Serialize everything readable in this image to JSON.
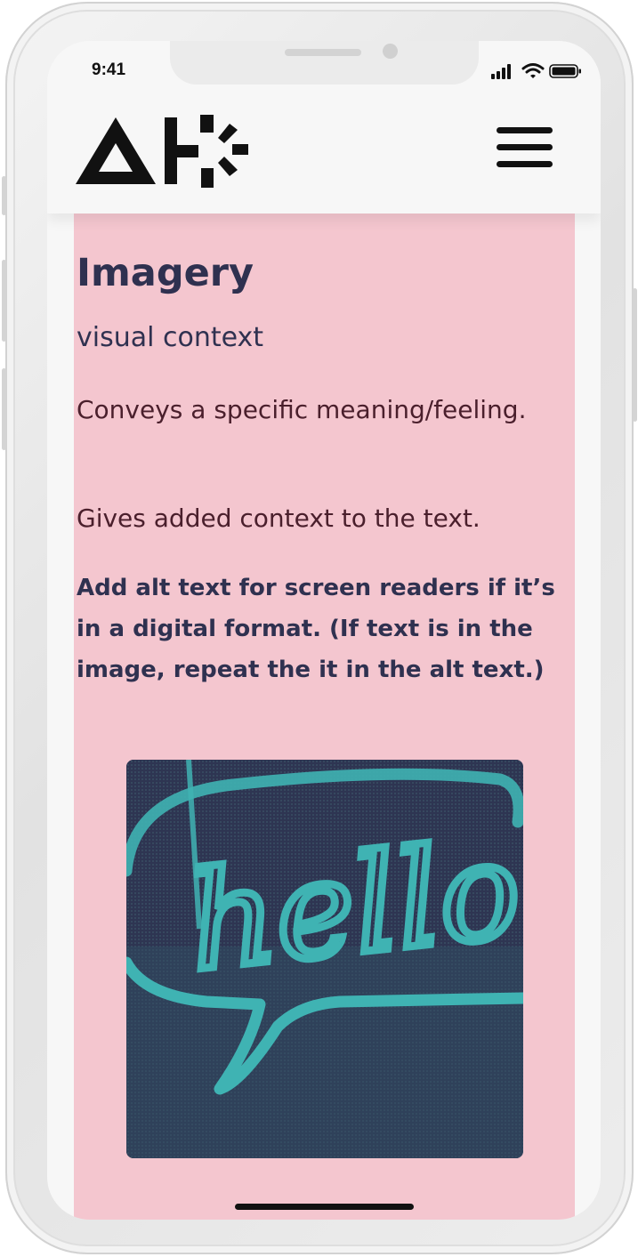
{
  "status_bar": {
    "time": "9:41",
    "icons": [
      "cellular-signal-icon",
      "wifi-icon",
      "battery-icon"
    ]
  },
  "header": {
    "logo_name": "alt-logo",
    "menu_icon": "hamburger-menu-icon"
  },
  "content": {
    "title": "Imagery",
    "subtitle": "visual context",
    "paragraphs": [
      "Conveys a specific meaning/feeling.",
      "Gives added context to the text."
    ],
    "note": "Add alt text for screen readers if it’s in a digital format. (If text is in the image, repeat the it in the alt text.)",
    "image_alt": "Neon sign reading hello inside a speech bubble",
    "image_text": "hello"
  },
  "colors": {
    "card_background": "#f4c6cf",
    "heading_text": "#2f3150",
    "body_text": "#4a1f2c",
    "neon": "#3fb3b3",
    "image_background": "#333a57",
    "header_background": "#f7f7f7"
  }
}
